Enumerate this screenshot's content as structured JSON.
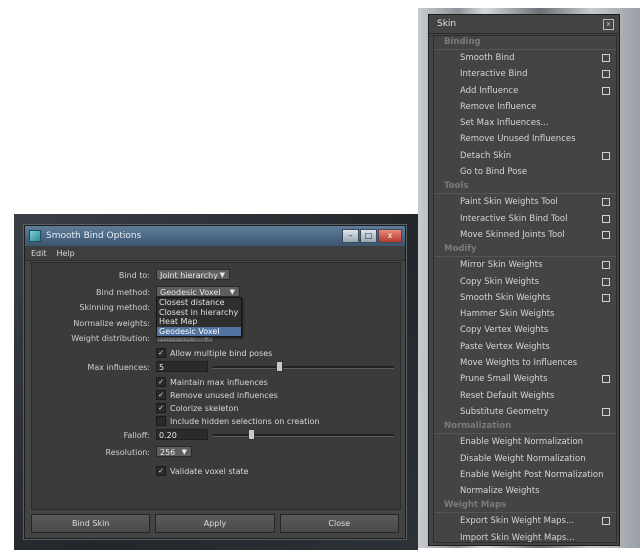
{
  "dialog": {
    "title": "Smooth Bind Options",
    "menu": [
      "Edit",
      "Help"
    ],
    "bind_to": {
      "label": "Bind to:",
      "value": "Joint hierarchy"
    },
    "bind_method": {
      "label": "Bind method:",
      "value": "Geodesic Voxel"
    },
    "skinning_method": {
      "label": "Skinning method:"
    },
    "normalize_weights": {
      "label": "Normalize weights:"
    },
    "weight_distribution": {
      "label": "Weight distribution:",
      "value": "Distance"
    },
    "bind_method_options": [
      "Closest distance",
      "Closest in hierarchy",
      "Heat Map",
      "Geodesic Voxel"
    ],
    "allow_multiple": "Allow multiple bind poses",
    "max_influences": {
      "label": "Max influences:",
      "value": "5",
      "slider_fraction": 0.35
    },
    "checks": [
      "Maintain max influences",
      "Remove unused influences",
      "Colorize skeleton",
      "Include hidden selections on creation"
    ],
    "checks_state": [
      true,
      true,
      true,
      false
    ],
    "falloff": {
      "label": "Falloff:",
      "value": "0.20",
      "slider_fraction": 0.2
    },
    "resolution": {
      "label": "Resolution:",
      "value": "256"
    },
    "validate": "Validate voxel state",
    "buttons": {
      "bind": "Bind Skin",
      "apply": "Apply",
      "close": "Close"
    },
    "window_buttons": {
      "min": "–",
      "max": "□",
      "close": "x"
    }
  },
  "skin_menu": {
    "title": "Skin",
    "close_label": "x",
    "sections": [
      {
        "header": "Binding",
        "items": [
          {
            "label": "Smooth Bind",
            "box": true
          },
          {
            "label": "Interactive Bind",
            "box": true
          },
          {
            "label": "Add Influence",
            "box": true
          },
          {
            "label": "Remove Influence",
            "box": false
          },
          {
            "label": "Set Max Influences...",
            "box": false
          },
          {
            "label": "Remove Unused Influences",
            "box": false
          },
          {
            "label": "Detach Skin",
            "box": true
          },
          {
            "label": "Go to Bind Pose",
            "box": false
          }
        ]
      },
      {
        "header": "Tools",
        "items": [
          {
            "label": "Paint Skin Weights Tool",
            "box": true
          },
          {
            "label": "Interactive Skin Bind Tool",
            "box": true
          },
          {
            "label": "Move Skinned Joints Tool",
            "box": true
          }
        ]
      },
      {
        "header": "Modify",
        "items": [
          {
            "label": "Mirror Skin Weights",
            "box": true
          },
          {
            "label": "Copy Skin Weights",
            "box": true
          },
          {
            "label": "Smooth Skin Weights",
            "box": true
          },
          {
            "label": "Hammer Skin Weights",
            "box": false
          },
          {
            "label": "Copy Vertex Weights",
            "box": false
          },
          {
            "label": "Paste Vertex Weights",
            "box": false
          },
          {
            "label": "Move Weights to Influences",
            "box": false
          },
          {
            "label": "Prune Small Weights",
            "box": true
          },
          {
            "label": "Reset Default Weights",
            "box": false
          },
          {
            "label": "Substitute Geometry",
            "box": true
          }
        ]
      },
      {
        "header": "Normalization",
        "items": [
          {
            "label": "Enable Weight Normalization",
            "box": false
          },
          {
            "label": "Disable Weight Normalization",
            "box": false
          },
          {
            "label": "Enable Weight Post Normalization",
            "box": false
          },
          {
            "label": "Normalize Weights",
            "box": false
          }
        ]
      },
      {
        "header": "Weight Maps",
        "items": [
          {
            "label": "Export Skin Weight Maps...",
            "box": true
          },
          {
            "label": "Import Skin Weight Maps...",
            "box": false
          }
        ]
      }
    ]
  },
  "colors": {
    "panel": "#444444",
    "title_bar": "#4a6886",
    "highlight": "#5073a0"
  }
}
